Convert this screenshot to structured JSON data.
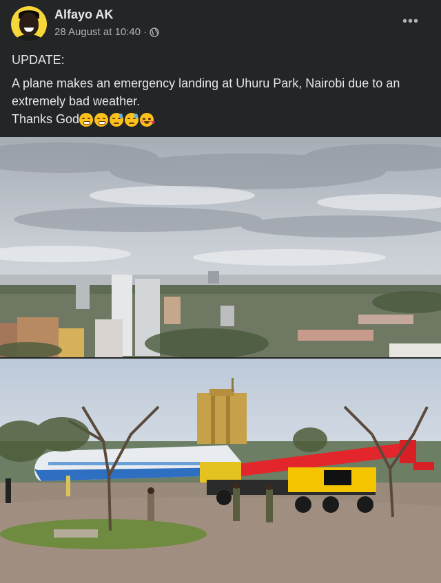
{
  "post": {
    "author": "Alfayo AK",
    "timestamp": "28 August at 10:40",
    "separator": "·",
    "privacy_icon": "globe-icon",
    "more_icon": "more-options-icon",
    "more_label": "•••",
    "text_update": "UPDATE:",
    "text_body": " A plane makes an emergency landing at Uhuru Park, Nairobi due to an extremely bad weather.",
    "text_thanks": "Thanks God"
  },
  "emojis": [
    "grimacing-face",
    "grimacing-face",
    "sweat-face",
    "sweat-face",
    "smiling-face-with-hearts"
  ],
  "colors": {
    "background": "#242526",
    "text_primary": "#e4e6eb",
    "text_secondary": "#b0b3b8",
    "crane_red": "#e3262b",
    "truck_yellow": "#f5c400",
    "plane_blue": "#2f6fc1"
  }
}
